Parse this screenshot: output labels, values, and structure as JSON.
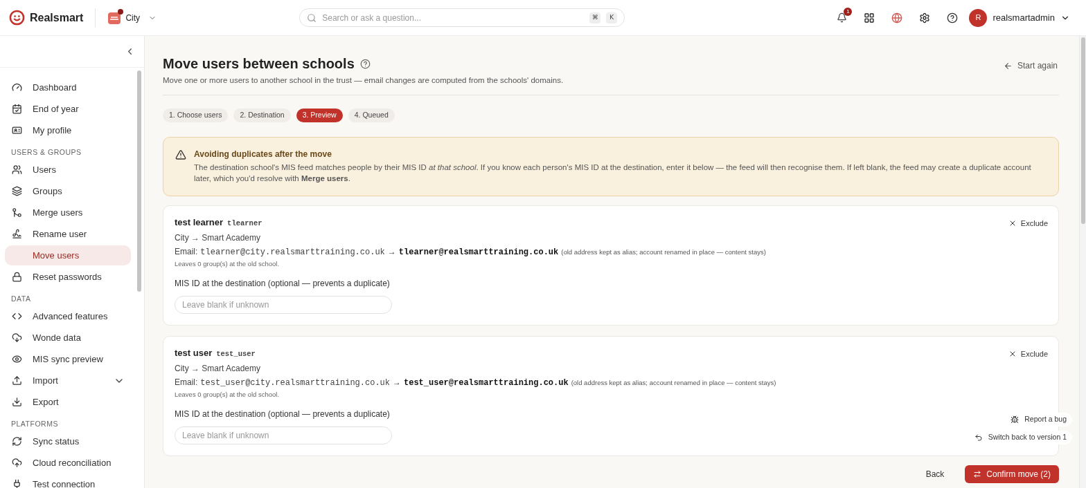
{
  "header": {
    "brand": "Realsmart",
    "school": "City",
    "search": {
      "placeholder": "Search or ask a question...",
      "keys": [
        "⌘",
        "K"
      ]
    },
    "notifications": "1",
    "user": {
      "initial": "R",
      "name": "realsmartadmin"
    }
  },
  "sidebar": {
    "sections": [
      {
        "items": [
          {
            "label": "Dashboard",
            "kind": "link",
            "selected": false
          },
          {
            "label": "End of year",
            "kind": "link",
            "selected": false
          },
          {
            "label": "My profile",
            "kind": "link",
            "selected": false
          }
        ]
      },
      {
        "heading": "USERS & GROUPS",
        "items": [
          {
            "label": "Users",
            "kind": "link",
            "selected": false
          },
          {
            "label": "Groups",
            "kind": "link",
            "selected": false
          },
          {
            "label": "Merge users",
            "kind": "link",
            "selected": false
          },
          {
            "label": "Rename user",
            "kind": "link",
            "selected": false
          },
          {
            "label": "Move users",
            "kind": "link",
            "selected": true
          },
          {
            "label": "Reset passwords",
            "kind": "link",
            "selected": false
          }
        ]
      },
      {
        "heading": "DATA",
        "items": [
          {
            "label": "Advanced features",
            "kind": "link",
            "selected": false
          },
          {
            "label": "Wonde data",
            "kind": "link",
            "selected": false
          },
          {
            "label": "MIS sync preview",
            "kind": "link",
            "selected": false
          },
          {
            "label": "Import",
            "kind": "group",
            "selected": false
          },
          {
            "label": "Export",
            "kind": "link",
            "selected": false
          }
        ]
      },
      {
        "heading": "PLATFORMS",
        "items": [
          {
            "label": "Sync status",
            "kind": "link",
            "selected": false
          },
          {
            "label": "Cloud reconciliation",
            "kind": "link",
            "selected": false
          },
          {
            "label": "Test connection",
            "kind": "link",
            "selected": false
          }
        ]
      }
    ]
  },
  "page": {
    "title": "Move users between schools",
    "subtitle": "Move one or more users to another school in the trust — email changes are computed from the schools' domains.",
    "start_again": "Start again"
  },
  "steps": [
    {
      "label": "1. Choose users",
      "selected": false
    },
    {
      "label": "2. Destination",
      "selected": false
    },
    {
      "label": "3. Preview",
      "selected": true
    },
    {
      "label": "4. Queued",
      "selected": false
    }
  ],
  "alert": {
    "title": "Avoiding duplicates after the move",
    "body": "The destination school's MIS feed matches people by their MIS ID *at that school*. If you know each person's MIS ID at the destination, enter it below — the feed will then recognise them. If left blank, the feed may create a duplicate account later, which you'd resolve with **Merge users**."
  },
  "users": [
    {
      "name": "test learner",
      "username": "tlearner",
      "move": "City → Smart Academy",
      "email_label": "Email:",
      "old_email": "tlearner@city.realsmarttraining.co.uk",
      "arrow": "→",
      "new_email": "tlearner@realsmarttraining.co.uk",
      "note": "(old address kept as alias; account renamed in place — content stays)",
      "groups": "Leaves 0 group(s) at the old school.",
      "mis_label": "MIS ID at the destination (optional — prevents a duplicate)",
      "mis_placeholder": "Leave blank if unknown",
      "exclude": "Exclude"
    },
    {
      "name": "test user",
      "username": "test_user",
      "move": "City → Smart Academy",
      "email_label": "Email:",
      "old_email": "test_user@city.realsmarttraining.co.uk",
      "arrow": "→",
      "new_email": "test_user@realsmarttraining.co.uk",
      "note": "(old address kept as alias; account renamed in place — content stays)",
      "groups": "Leaves 0 group(s) at the old school.",
      "mis_label": "MIS ID at the destination (optional — prevents a duplicate)",
      "mis_placeholder": "Leave blank if unknown",
      "exclude": "Exclude"
    }
  ],
  "floating": {
    "report_bug": "Report a bug",
    "switch_back": "Switch back to version 1"
  },
  "footer": {
    "back": "Back",
    "confirm": "Confirm move (2)"
  }
}
